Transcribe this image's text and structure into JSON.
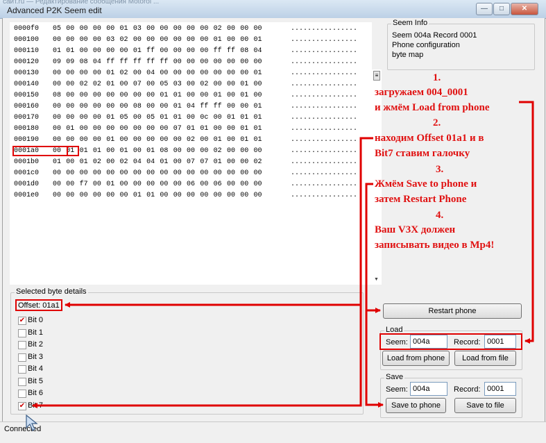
{
  "window": {
    "title": "Advanced P2K Seem edit",
    "background_title": "сайт.ru — Редактирование сообщения Motorol ..."
  },
  "hex_rows": [
    {
      "offset": "0000f0",
      "bytes": "05 00 00 00 00 01 03 00 00 00 00 00 02 00 00 00",
      "ascii": "................"
    },
    {
      "offset": "000100",
      "bytes": "00 00 00 00 03 02 00 00 00 00 00 00 01 00 00 01",
      "ascii": "................"
    },
    {
      "offset": "000110",
      "bytes": "01 01 00 00 00 00 01 ff 00 00 00 00 ff ff 08 04",
      "ascii": "................"
    },
    {
      "offset": "000120",
      "bytes": "09 09 08 04 ff ff ff ff ff 00 00 00 00 00 00 00",
      "ascii": "................"
    },
    {
      "offset": "000130",
      "bytes": "00 00 00 00 01 02 00 04 00 00 00 00 00 00 00 01",
      "ascii": "................"
    },
    {
      "offset": "000140",
      "bytes": "00 00 02 02 01 00 07 00 05 03 00 02 00 00 01 00",
      "ascii": "................"
    },
    {
      "offset": "000150",
      "bytes": "08 00 00 00 00 00 00 00 01 01 00 00 01 00 01 00",
      "ascii": "................"
    },
    {
      "offset": "000160",
      "bytes": "00 00 00 00 00 00 08 00 00 01 04 ff ff 00 00 01",
      "ascii": "................"
    },
    {
      "offset": "000170",
      "bytes": "00 00 00 00 01 05 00 05 01 01 00 0c 00 01 01 01",
      "ascii": "................"
    },
    {
      "offset": "000180",
      "bytes": "00 01 00 00 00 00 00 00 00 07 01 01 00 00 01 01",
      "ascii": "................"
    },
    {
      "offset": "000190",
      "bytes": "00 00 00 00 01 00 00 00 00 00 02 00 01 00 01 01",
      "ascii": "................"
    },
    {
      "offset": "0001a0",
      "bytes": "00 01 01 01 00 01 00 01 08 00 00 00 02 00 00 00",
      "ascii": "................"
    },
    {
      "offset": "0001b0",
      "bytes": "01 00 01 02 00 02 04 04 01 00 07 07 01 00 00 02",
      "ascii": "................"
    },
    {
      "offset": "0001c0",
      "bytes": "00 00 00 00 00 00 00 00 00 00 00 00 00 00 00 00",
      "ascii": "................"
    },
    {
      "offset": "0001d0",
      "bytes": "00 00 f7 00 01 00 00 00 00 00 06 00 06 00 00 00",
      "ascii": "................"
    },
    {
      "offset": "0001e0",
      "bytes": "00 00 00 00 00 00 01 01 00 00 00 00 00 00 00 00",
      "ascii": "................"
    }
  ],
  "seem_info": {
    "legend": "Seem Info",
    "line1": "Seem 004a Record 0001",
    "line2": "Phone configuration",
    "line3": "byte map"
  },
  "byte_details": {
    "legend": "Selected byte details",
    "offset_label": "Offset: 01a1",
    "bits": [
      {
        "label": "Bit 0",
        "checked": true
      },
      {
        "label": "Bit 1",
        "checked": false
      },
      {
        "label": "Bit 2",
        "checked": false
      },
      {
        "label": "Bit 3",
        "checked": false
      },
      {
        "label": "Bit 4",
        "checked": false
      },
      {
        "label": "Bit 5",
        "checked": false
      },
      {
        "label": "Bit 6",
        "checked": false
      },
      {
        "label": "Bit 7",
        "checked": true
      }
    ]
  },
  "buttons": {
    "restart": "Restart phone",
    "load_phone": "Load from phone",
    "load_file": "Load from file",
    "save_phone": "Save to phone",
    "save_file": "Save to file"
  },
  "load": {
    "legend": "Load",
    "seem_label": "Seem:",
    "seem_value": "004a",
    "record_label": "Record:",
    "record_value": "0001"
  },
  "save": {
    "legend": "Save",
    "seem_label": "Seem:",
    "seem_value": "004a",
    "record_label": "Record:",
    "record_value": "0001"
  },
  "status": "Connected",
  "annotations": {
    "n1": "1.",
    "l1a": "загружаем 004_0001",
    "l1b": "и жмём Load from phone",
    "n2": "2.",
    "l2a": "находим Offset 01a1 и в",
    "l2b": "Bit7 ставим галочку",
    "n3": "3.",
    "l3a": "Жмём Save to phone и",
    "l3b": "затем Restart Phone",
    "n4": "4.",
    "l4a": "Ваш V3X должен",
    "l4b": "записывать видео в Mp4!"
  },
  "colors": {
    "annotation_red": "#e00000",
    "titlebar": "#c9dbee"
  }
}
